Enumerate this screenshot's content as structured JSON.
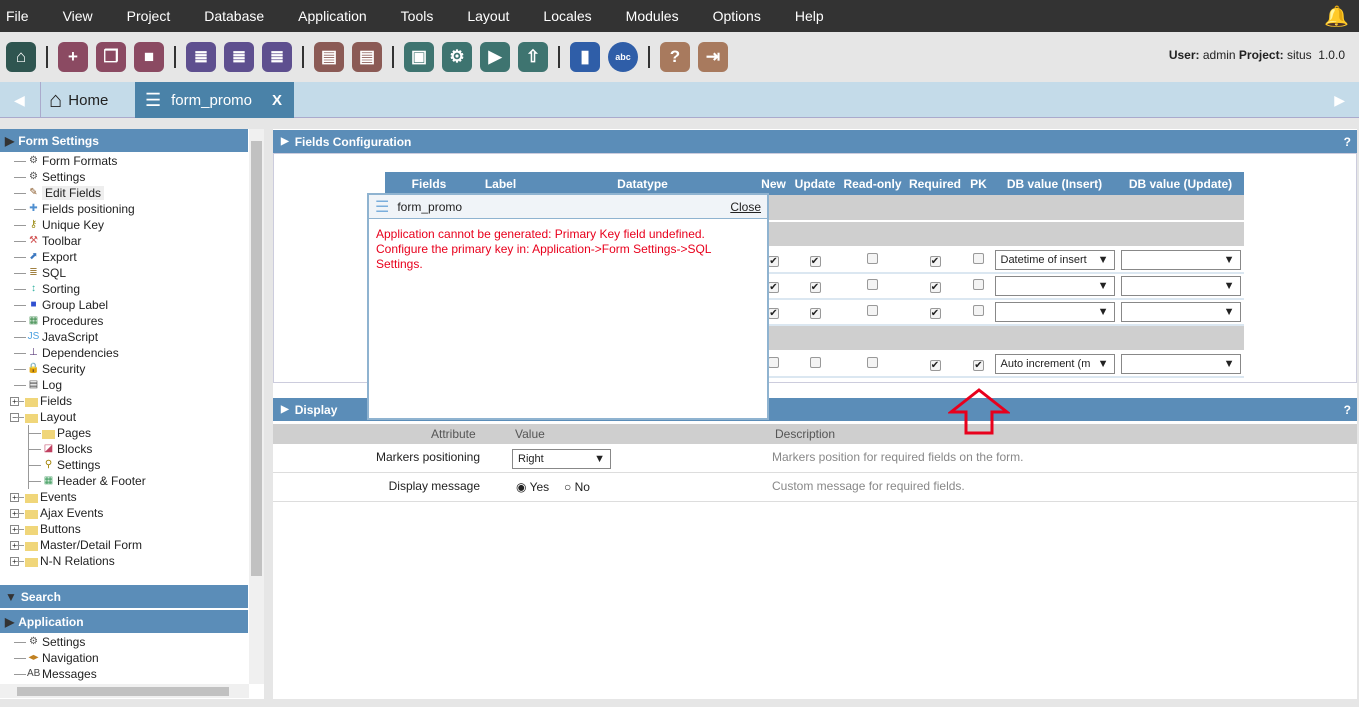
{
  "menu": [
    "File",
    "View",
    "Project",
    "Database",
    "Application",
    "Tools",
    "Layout",
    "Locales",
    "Modules",
    "Options",
    "Help"
  ],
  "toolbar": [
    {
      "name": "home",
      "glyph": "⌂",
      "color": "#2f5550"
    },
    {
      "sep": true
    },
    {
      "name": "new-project",
      "glyph": "+",
      "color": "#8b4a62"
    },
    {
      "name": "open-project",
      "glyph": "❒",
      "color": "#8b4a62"
    },
    {
      "name": "close-project",
      "glyph": "■",
      "color": "#8b4a62"
    },
    {
      "sep": true
    },
    {
      "name": "new-app",
      "glyph": "≣",
      "color": "#5e4f8f"
    },
    {
      "name": "edit-app",
      "glyph": "≣",
      "color": "#5e4f8f"
    },
    {
      "name": "list-apps",
      "glyph": "≣",
      "color": "#5e4f8f"
    },
    {
      "sep": true
    },
    {
      "name": "document",
      "glyph": "▤",
      "color": "#8b5a55"
    },
    {
      "name": "documents",
      "glyph": "▤",
      "color": "#8b5a55"
    },
    {
      "sep": true
    },
    {
      "name": "save",
      "glyph": "▣",
      "color": "#3e7470"
    },
    {
      "name": "generate",
      "glyph": "⚙",
      "color": "#3e7470"
    },
    {
      "name": "run",
      "glyph": "▶",
      "color": "#3e7470"
    },
    {
      "name": "publish",
      "glyph": "⇧",
      "color": "#3e7470"
    },
    {
      "sep": true
    },
    {
      "name": "book",
      "glyph": "▮",
      "color": "#2f5ea8"
    },
    {
      "name": "spell-check",
      "glyph": "abc",
      "color": "#2f5ea8"
    },
    {
      "sep": true
    },
    {
      "name": "help",
      "glyph": "?",
      "color": "#a87a5e"
    },
    {
      "name": "exit",
      "glyph": "⇥",
      "color": "#a87a5e"
    }
  ],
  "user": {
    "user_label": "User:",
    "user": "admin",
    "project_label": "Project:",
    "project": "situs",
    "version": "1.0.0"
  },
  "tabs": {
    "home": "Home",
    "active": "form_promo",
    "close": "X"
  },
  "sidebar": {
    "form_settings": "Form Settings",
    "items": [
      {
        "label": "Form Formats",
        "icon": "⚙",
        "color": "#555"
      },
      {
        "label": "Settings",
        "icon": "⚙",
        "color": "#555"
      },
      {
        "label": "Edit Fields",
        "icon": "✎",
        "color": "#8a5a2a",
        "selected": true
      },
      {
        "label": "Fields positioning",
        "icon": "✚",
        "color": "#4f8fd0"
      },
      {
        "label": "Unique Key",
        "icon": "⚷",
        "color": "#9a8a10"
      },
      {
        "label": "Toolbar",
        "icon": "⚒",
        "color": "#d05050"
      },
      {
        "label": "Export",
        "icon": "⬈",
        "color": "#3c78c0"
      },
      {
        "label": "SQL",
        "icon": "≣",
        "color": "#a08040"
      },
      {
        "label": "Sorting",
        "icon": "↕",
        "color": "#30b0a0"
      },
      {
        "label": "Group Label",
        "icon": "■",
        "color": "#3050d0"
      },
      {
        "label": "Procedures",
        "icon": "▦",
        "color": "#3a8a4a"
      },
      {
        "label": "JavaScript",
        "icon": "JS",
        "color": "#4aa0e0"
      },
      {
        "label": "Dependencies",
        "icon": "⊥",
        "color": "#5a3a7a"
      },
      {
        "label": "Security",
        "icon": "🔒",
        "color": "#8aa030"
      },
      {
        "label": "Log",
        "icon": "▤",
        "color": "#444"
      },
      {
        "label": "Fields",
        "folder": true,
        "pm": "+"
      },
      {
        "label": "Layout",
        "folder": true,
        "pm": "−"
      },
      {
        "label": "Pages",
        "folder": true,
        "child": true
      },
      {
        "label": "Blocks",
        "icon": "◪",
        "color": "#c04060",
        "child": true
      },
      {
        "label": "Settings",
        "icon": "⚲",
        "color": "#a08000",
        "child": true
      },
      {
        "label": "Header & Footer",
        "icon": "▦",
        "color": "#3a9a5a",
        "child": true
      },
      {
        "label": "Events",
        "folder": true,
        "pm": "+"
      },
      {
        "label": "Ajax Events",
        "folder": true,
        "pm": "+"
      },
      {
        "label": "Buttons",
        "folder": true,
        "pm": "+"
      },
      {
        "label": "Master/Detail Form",
        "folder": true,
        "pm": "+"
      },
      {
        "label": "N-N Relations",
        "folder": true,
        "pm": "+"
      }
    ],
    "search": "Search",
    "application": "Application",
    "app_items": [
      {
        "label": "Settings",
        "icon": "⚙",
        "color": "#555"
      },
      {
        "label": "Navigation",
        "icon": "◂▸",
        "color": "#c08020"
      },
      {
        "label": "Messages",
        "icon": "AB",
        "color": "#444"
      }
    ]
  },
  "fields_config": {
    "title": "Fields Configuration",
    "help": "?",
    "columns": [
      "Fields",
      "Label",
      "Datatype",
      "New",
      "Update",
      "Read-only",
      "Required",
      "PK",
      "DB value (Insert)",
      "DB value (Update)"
    ],
    "rows": [
      {
        "group": true
      },
      {
        "group": true
      },
      {
        "new": true,
        "update": true,
        "readonly": false,
        "required": true,
        "pk": false,
        "insert": "Datetime of insert",
        "upd": ""
      },
      {
        "new": true,
        "update": true,
        "readonly": false,
        "required": true,
        "pk": false,
        "insert": "",
        "upd": ""
      },
      {
        "new": true,
        "update": true,
        "readonly": false,
        "required": true,
        "pk": false,
        "insert": "",
        "upd": ""
      },
      {
        "group": true
      },
      {
        "new": false,
        "update": false,
        "readonly": false,
        "required": true,
        "pk": true,
        "insert": "Auto increment (m",
        "upd": ""
      }
    ]
  },
  "popup": {
    "title": "form_promo",
    "close": "Close",
    "message": "Application cannot be generated: Primary Key field undefined. Configure the primary key in: Application->Form Settings->SQL Settings."
  },
  "display": {
    "title": "Display",
    "help": "?",
    "headers": {
      "attribute": "Attribute",
      "value": "Value",
      "description": "Description"
    },
    "markers": {
      "label": "Markers positioning",
      "value": "Right",
      "description": "Markers position for required fields on the form."
    },
    "message": {
      "label": "Display message",
      "yes": "Yes",
      "no": "No",
      "selected": "Yes",
      "description": "Custom message for required fields."
    }
  },
  "colors": {
    "header_blue": "#5b8db8",
    "error_red": "#e8001c",
    "arrow_red": "#e8001c"
  }
}
